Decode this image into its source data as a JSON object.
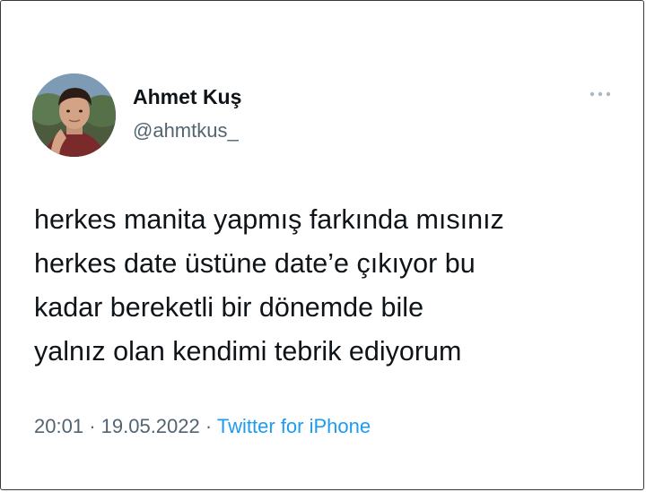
{
  "tweet": {
    "author": {
      "display_name": "Ahmet Kuş",
      "handle": "@ahmtkus_",
      "avatar_icon": "profile-photo"
    },
    "text_lines": [
      "herkes manita yapmış farkında mısınız",
      "herkes date üstüne date’e çıkıyor bu",
      "kadar bereketli bir dönemde bile",
      "yalnız olan kendimi tebrik ediyorum"
    ],
    "time": "20:01",
    "separator": "·",
    "date": "19.05.2022",
    "source": "Twitter for iPhone",
    "more_icon": "more-horizontal-icon"
  },
  "colors": {
    "text": "#0f1419",
    "secondary_text": "#536471",
    "link": "#1d9bf0",
    "more_icon": "#aab8c2"
  }
}
